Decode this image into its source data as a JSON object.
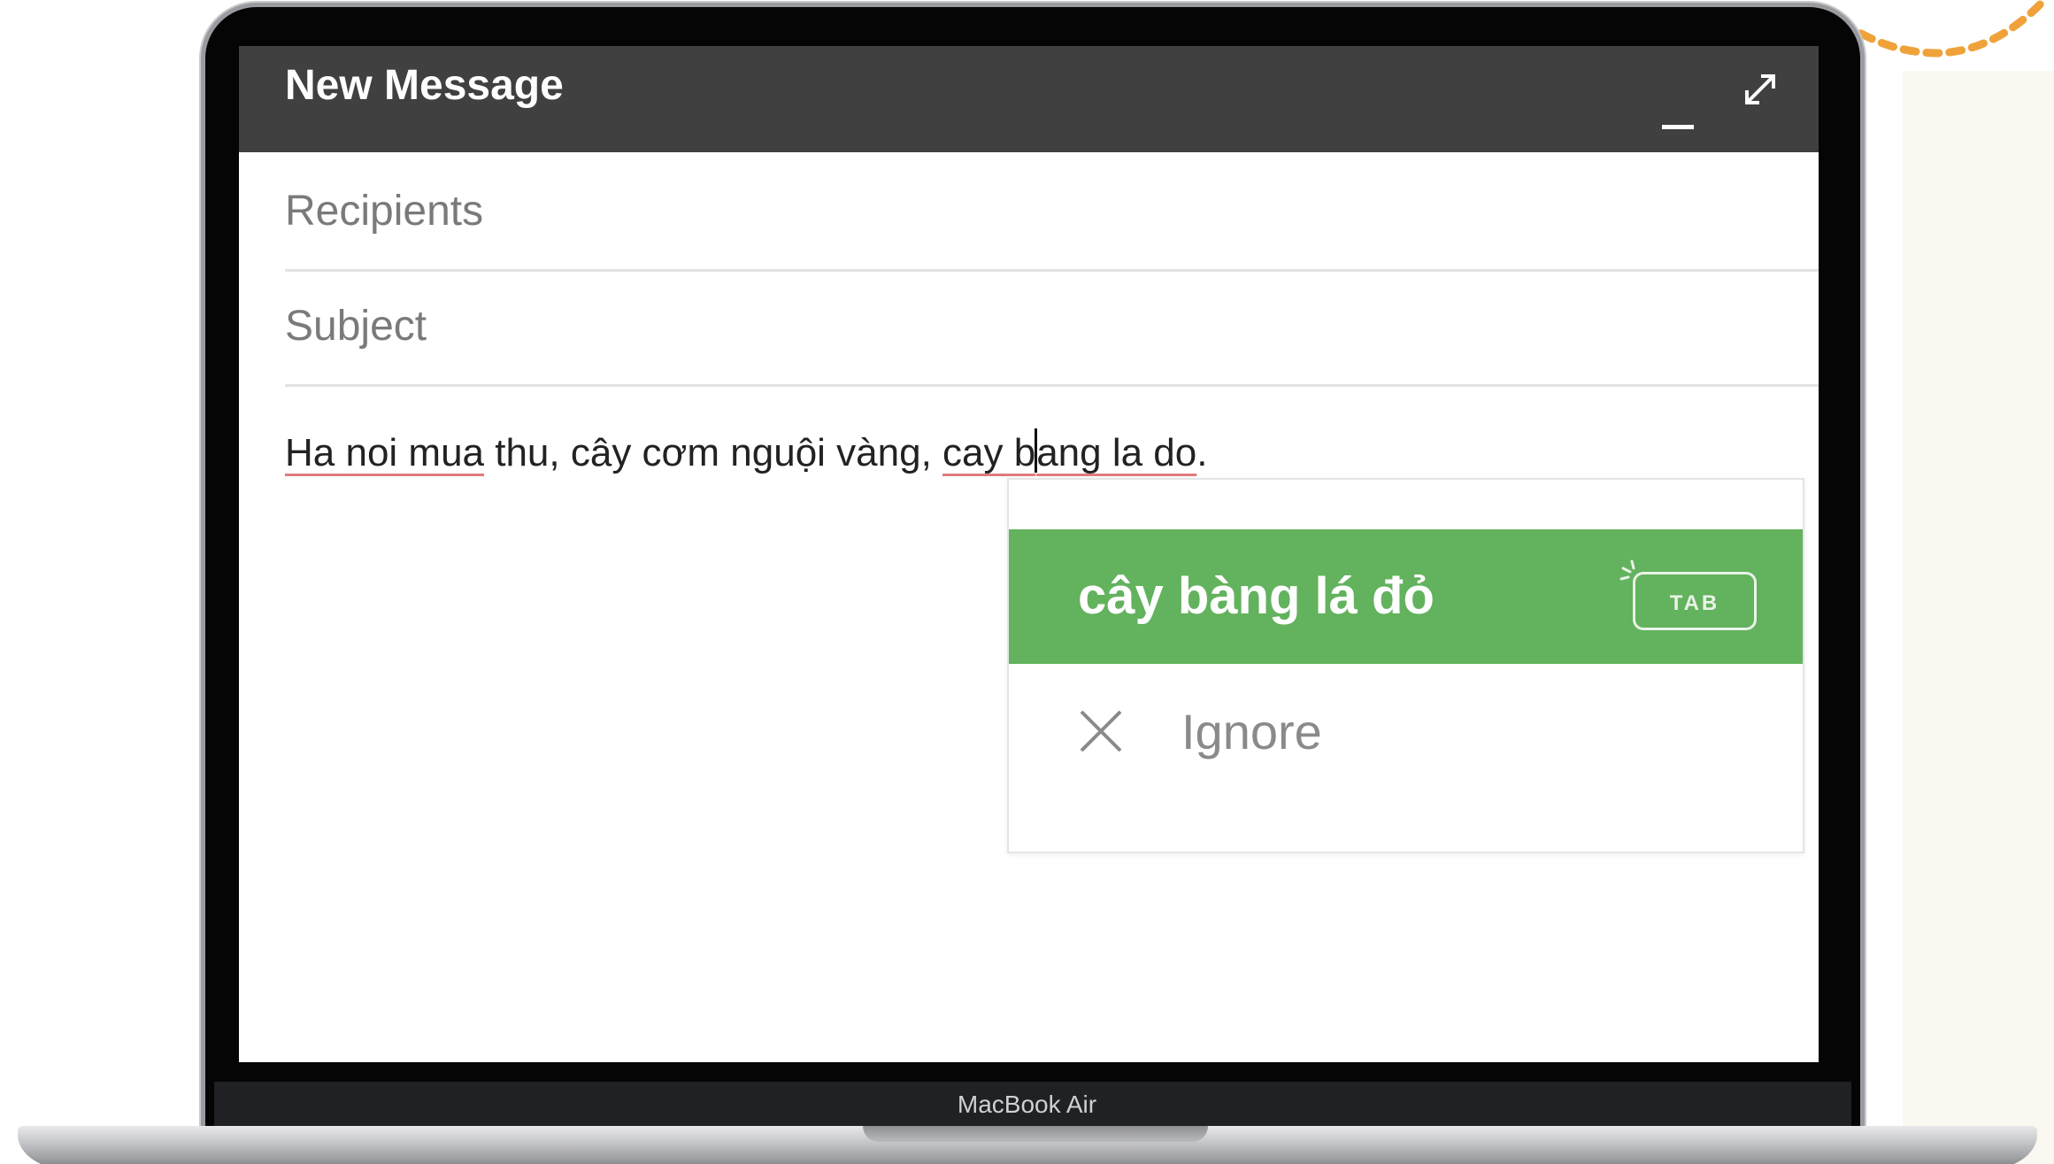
{
  "compose": {
    "title": "New Message",
    "recipients_placeholder": "Recipients",
    "subject_placeholder": "Subject",
    "body": {
      "part1": "Ha noi mua",
      "part2": " thu, cây cơm nguội vàng, ",
      "part3": "cay b",
      "part4": "ang la do",
      "part5": "."
    }
  },
  "suggestion": {
    "text": "cây bàng lá đỏ",
    "shortcut": "TAB",
    "ignore_label": "Ignore"
  },
  "device": {
    "label": "MacBook Air"
  },
  "colors": {
    "header": "#404040",
    "suggestion_green": "#63b25e",
    "spellcheck_underline": "#e07b7b",
    "accent_orange": "#f0a23a"
  },
  "icons": [
    "minimize-icon",
    "expand-icon",
    "spark-icon",
    "close-icon"
  ]
}
